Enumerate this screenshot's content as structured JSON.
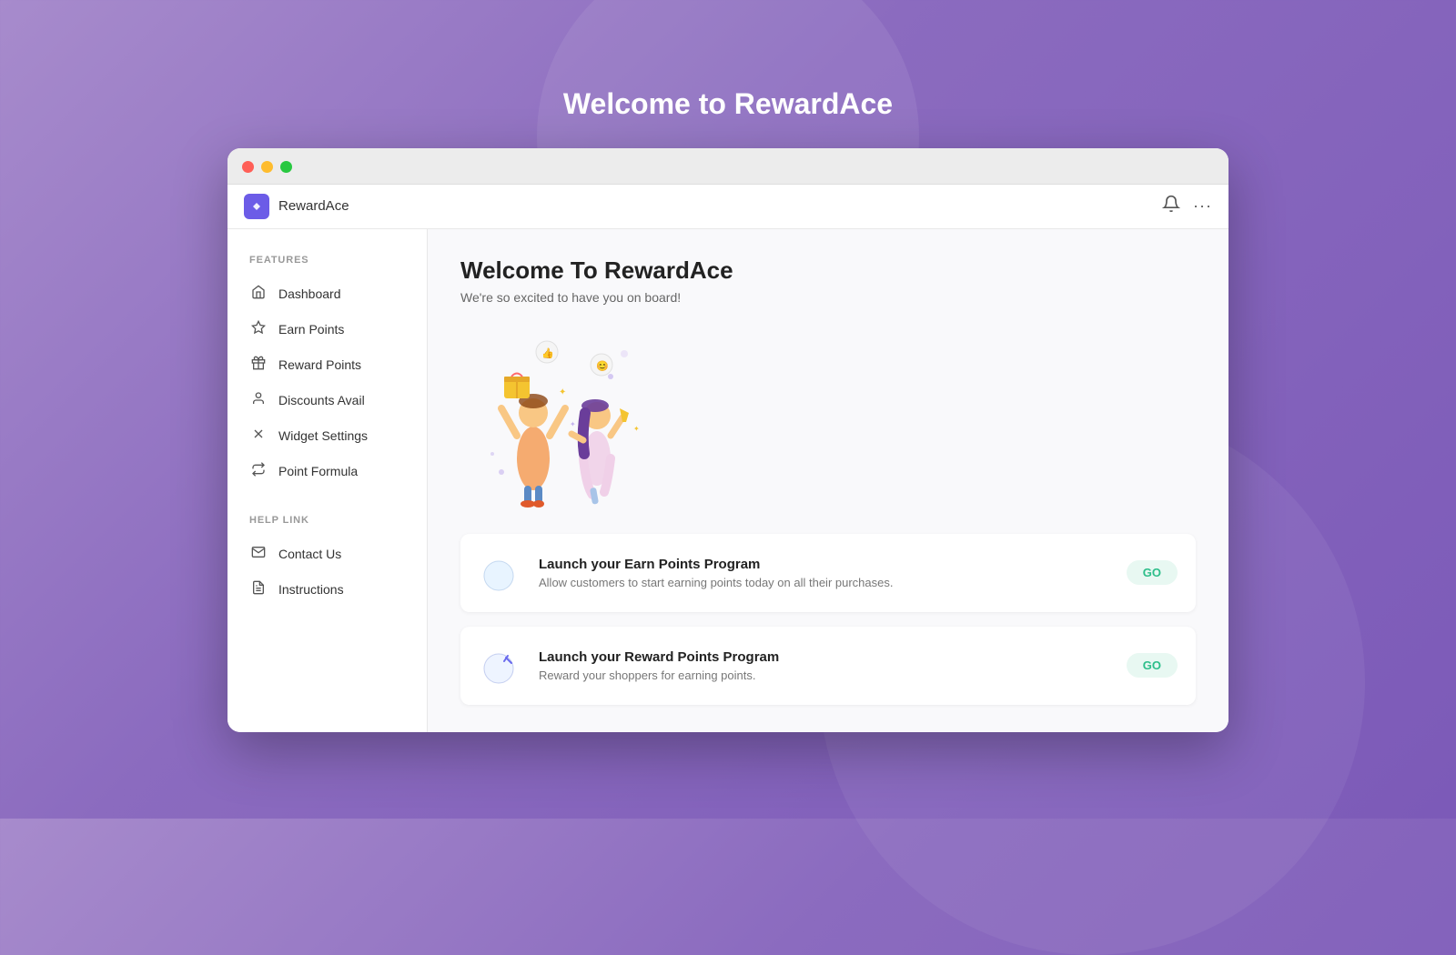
{
  "page": {
    "title": "Welcome to RewardAce"
  },
  "browser": {
    "dots": [
      "red",
      "yellow",
      "green"
    ]
  },
  "navbar": {
    "app_name": "RewardAce",
    "bell_icon": "🔔",
    "more_icon": "···"
  },
  "sidebar": {
    "features_label": "FEATURES",
    "help_label": "HELP LINK",
    "feature_items": [
      {
        "id": "dashboard",
        "label": "Dashboard",
        "icon": "🏠"
      },
      {
        "id": "earn-points",
        "label": "Earn Points",
        "icon": "☆"
      },
      {
        "id": "reward-points",
        "label": "Reward Points",
        "icon": "🎁"
      },
      {
        "id": "discounts-avail",
        "label": "Discounts Avail",
        "icon": "👤"
      },
      {
        "id": "widget-settings",
        "label": "Widget Settings",
        "icon": "✕"
      },
      {
        "id": "point-formula",
        "label": "Point Formula",
        "icon": "↻"
      }
    ],
    "help_items": [
      {
        "id": "contact-us",
        "label": "Contact Us",
        "icon": "✉"
      },
      {
        "id": "instructions",
        "label": "Instructions",
        "icon": "📄"
      }
    ]
  },
  "content": {
    "heading": "Welcome To RewardAce",
    "subtitle": "We're so excited to have you on board!",
    "cards": [
      {
        "id": "earn-points-card",
        "title": "Launch your Earn Points Program",
        "description": "Allow customers to start earning points today on all their purchases.",
        "button_label": "GO"
      },
      {
        "id": "reward-points-card",
        "title": "Launch your Reward Points Program",
        "description": "Reward your shoppers for earning points.",
        "button_label": "GO"
      }
    ]
  }
}
